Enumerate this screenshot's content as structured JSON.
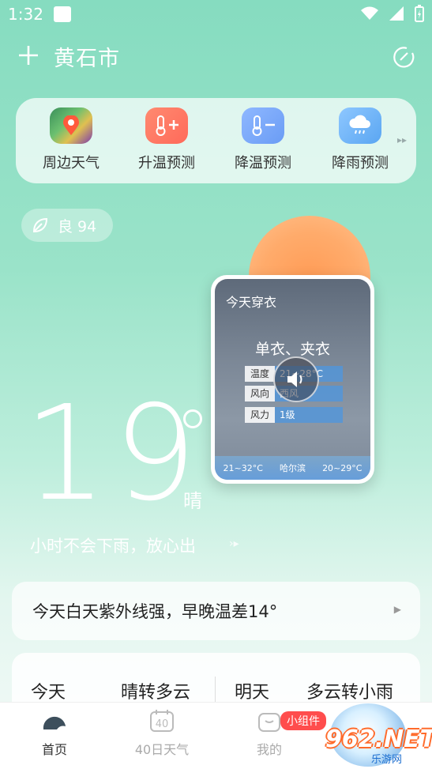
{
  "status": {
    "time": "1:32"
  },
  "header": {
    "city": "黄石市"
  },
  "shortcuts": [
    {
      "label": "周边天气",
      "icon": "map-pin-icon"
    },
    {
      "label": "升温预测",
      "icon": "thermometer-plus-icon"
    },
    {
      "label": "降温预测",
      "icon": "thermometer-minus-icon"
    },
    {
      "label": "降雨预测",
      "icon": "rain-cloud-icon"
    }
  ],
  "aqi": {
    "label": "良 94"
  },
  "clothing": {
    "title": "今天穿衣",
    "suggestion": "单衣、夹衣",
    "rows": [
      {
        "k": "温度",
        "v": "21~28°C"
      },
      {
        "k": "风向",
        "v": "西风"
      },
      {
        "k": "风力",
        "v": "1级"
      }
    ],
    "footer": [
      "21~32°C",
      "哈尔滨",
      "20~29°C"
    ]
  },
  "current": {
    "temperature": "19",
    "condition": "晴",
    "rain_message": "小时不会下雨，放心出"
  },
  "uv_card": {
    "text": "今天白天紫外线强，早晚温差14°"
  },
  "forecast": {
    "today_label": "今天",
    "today_cond": "晴转多云",
    "tomorrow_label": "明天",
    "tomorrow_cond": "多云转小雨"
  },
  "nav": {
    "items": [
      {
        "label": "首页"
      },
      {
        "label": "40日天气"
      },
      {
        "label": "我的"
      }
    ],
    "badge": "小组件"
  },
  "watermark": {
    "main": "962.NET",
    "sub": "乐游网"
  },
  "colors": {
    "accent": "#86dcc0",
    "sun": "#ff9b55",
    "badge": "#ff4d4d"
  }
}
